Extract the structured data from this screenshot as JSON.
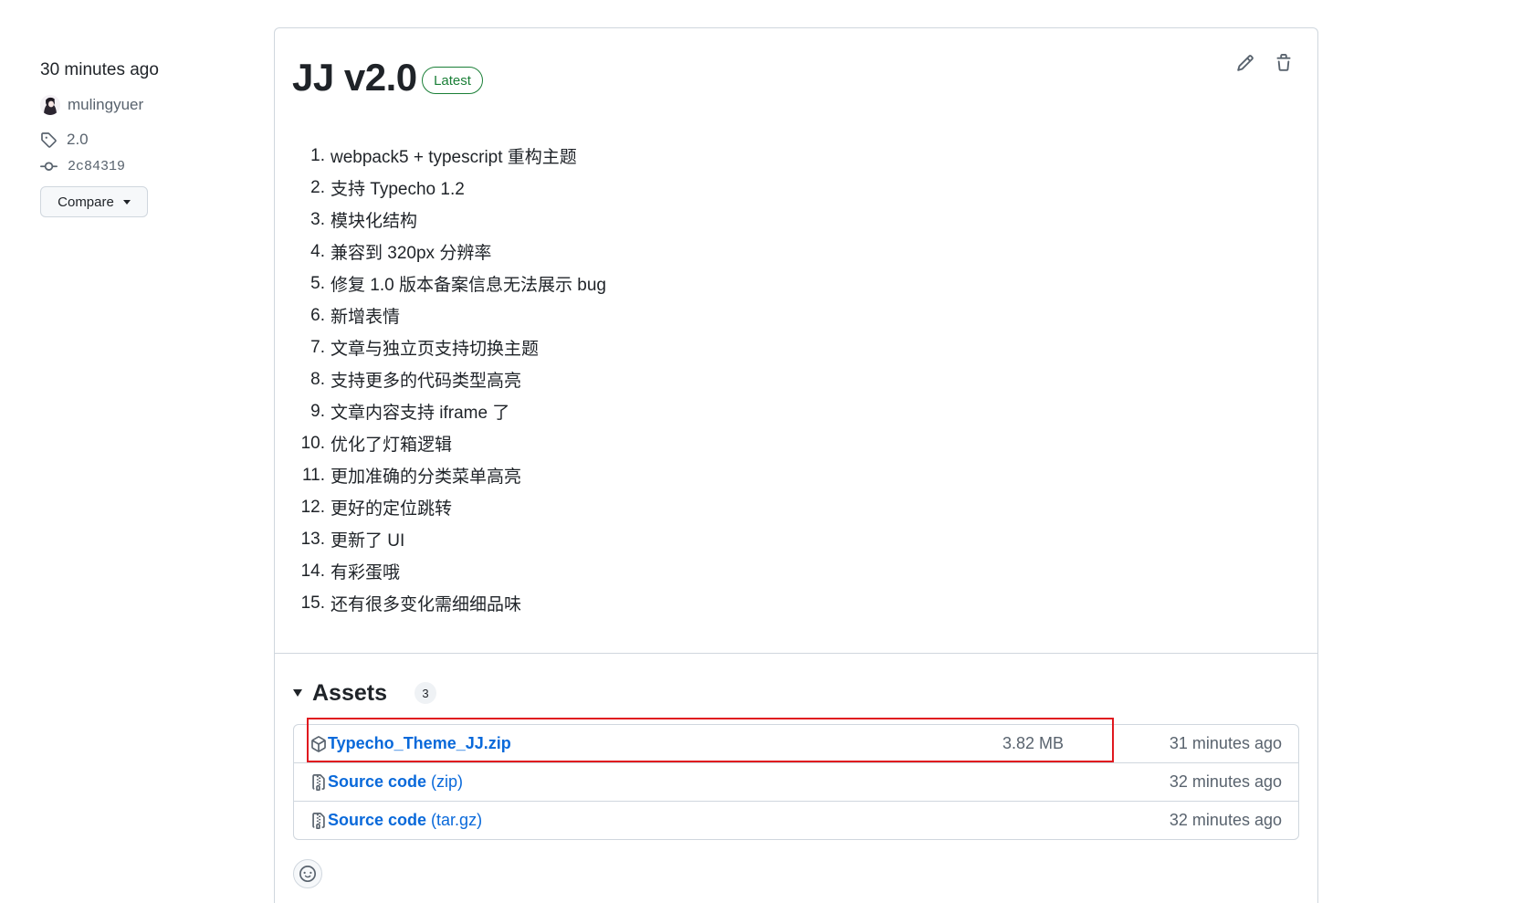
{
  "sidebar": {
    "published": "30 minutes ago",
    "author": "mulingyuer",
    "tag": "2.0",
    "commit": "2c84319",
    "compare_button": "Compare"
  },
  "release": {
    "title": "JJ v2.0",
    "badge": "Latest",
    "notes": [
      {
        "num": "1.",
        "text": "webpack5 + typescript 重构主题"
      },
      {
        "num": "2.",
        "text": "支持 Typecho 1.2"
      },
      {
        "num": "3.",
        "text": "模块化结构"
      },
      {
        "num": "4.",
        "text": "兼容到 320px 分辨率"
      },
      {
        "num": "5.",
        "text": "修复 1.0 版本备案信息无法展示 bug"
      },
      {
        "num": "6.",
        "text": "新增表情"
      },
      {
        "num": "7.",
        "text": "文章与独立页支持切换主题"
      },
      {
        "num": "8.",
        "text": "支持更多的代码类型高亮"
      },
      {
        "num": "9.",
        "text": "文章内容支持 iframe 了"
      },
      {
        "num": "10.",
        "text": "优化了灯箱逻辑"
      },
      {
        "num": "11.",
        "text": "更加准确的分类菜单高亮"
      },
      {
        "num": "12.",
        "text": "更好的定位跳转"
      },
      {
        "num": "13.",
        "text": "更新了 UI"
      },
      {
        "num": "14.",
        "text": "有彩蛋哦"
      },
      {
        "num": "15.",
        "text": "还有很多变化需细细品味"
      }
    ]
  },
  "assets": {
    "heading": "Assets",
    "count": "3",
    "items": [
      {
        "icon": "package-icon",
        "name": "Typecho_Theme_JJ.zip",
        "size": "3.82 MB",
        "time": "31 minutes ago",
        "highlighted": true
      },
      {
        "icon": "file-zip-icon",
        "name": "Source code",
        "suffix": "(zip)",
        "time": "32 minutes ago"
      },
      {
        "icon": "file-zip-icon",
        "name": "Source code",
        "suffix": "(tar.gz)",
        "time": "32 minutes ago"
      }
    ]
  },
  "icons": {
    "author": "avatar",
    "tag": "tag-icon",
    "commit": "commit-icon",
    "compare": "caret-down-icon",
    "edit": "pencil-icon",
    "delete": "trash-icon",
    "assets_toggle": "triangle-down-icon",
    "reaction": "smiley-icon"
  },
  "colors": {
    "text": "#1f2328",
    "muted": "#59636e",
    "link": "#0969da",
    "border": "#d0d7de",
    "latest_badge": "#1a7f37",
    "highlight_box": "#e0191f"
  }
}
